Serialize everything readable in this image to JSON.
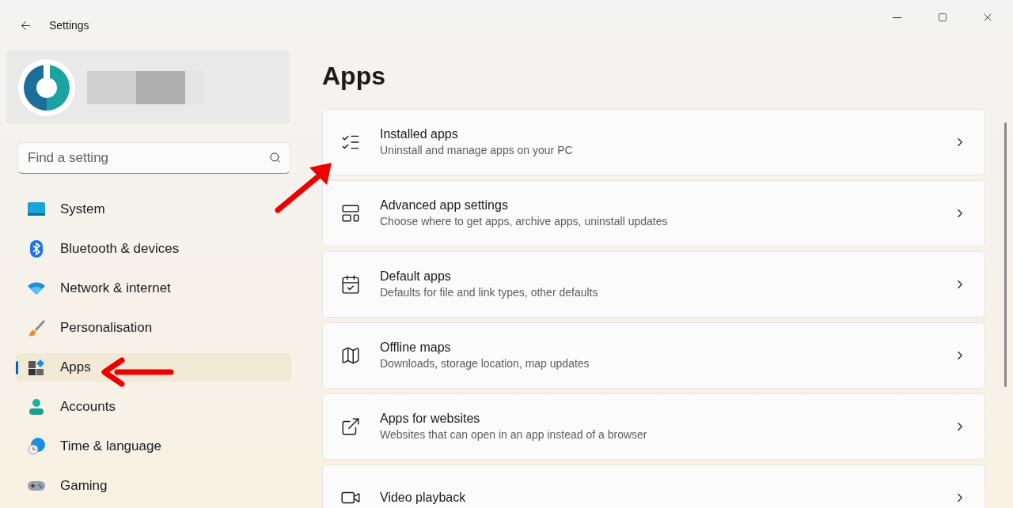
{
  "window": {
    "title": "Settings"
  },
  "search": {
    "placeholder": "Find a setting"
  },
  "nav": [
    {
      "label": "System",
      "selected": false
    },
    {
      "label": "Bluetooth & devices",
      "selected": false
    },
    {
      "label": "Network & internet",
      "selected": false
    },
    {
      "label": "Personalisation",
      "selected": false
    },
    {
      "label": "Apps",
      "selected": true
    },
    {
      "label": "Accounts",
      "selected": false
    },
    {
      "label": "Time & language",
      "selected": false
    },
    {
      "label": "Gaming",
      "selected": false
    }
  ],
  "page_title": "Apps",
  "cards": [
    {
      "title": "Installed apps",
      "subtitle": "Uninstall and manage apps on your PC"
    },
    {
      "title": "Advanced app settings",
      "subtitle": "Choose where to get apps, archive apps, uninstall updates"
    },
    {
      "title": "Default apps",
      "subtitle": "Defaults for file and link types, other defaults"
    },
    {
      "title": "Offline maps",
      "subtitle": "Downloads, storage location, map updates"
    },
    {
      "title": "Apps for websites",
      "subtitle": "Websites that can open in an app instead of a browser"
    },
    {
      "title": "Video playback"
    }
  ]
}
